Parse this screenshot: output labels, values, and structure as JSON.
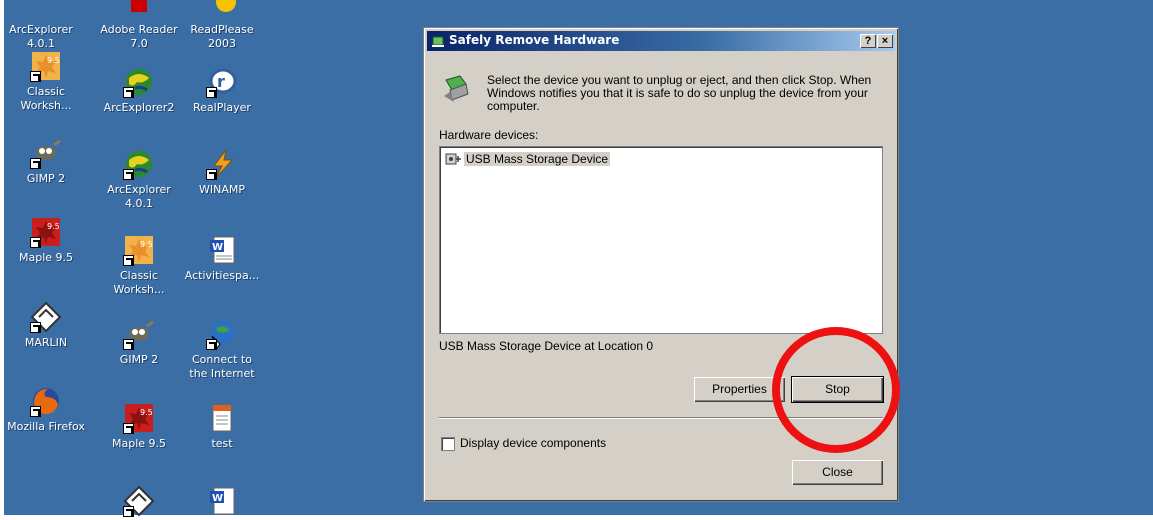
{
  "desktop": {
    "icons": [
      {
        "label": "ArcExplorer\n4.0.1",
        "icon": "globe-icon"
      },
      {
        "label": "Adobe Reader\n7.0",
        "icon": "pdf-icon"
      },
      {
        "label": "ReadPlease\n2003",
        "icon": "readplease-icon"
      },
      {
        "label": "Classic\nWorksh...",
        "icon": "maple-leaf-icon"
      },
      {
        "label": "ArcExplorer2",
        "icon": "globe-icon"
      },
      {
        "label": "RealPlayer",
        "icon": "realplayer-icon"
      },
      {
        "label": "GIMP 2",
        "icon": "gimp-icon"
      },
      {
        "label": "ArcExplorer\n4.0.1",
        "icon": "globe-icon"
      },
      {
        "label": "WINAMP",
        "icon": "winamp-icon"
      },
      {
        "label": "Maple 9.5",
        "icon": "maple-leaf-icon"
      },
      {
        "label": "Classic\nWorksh...",
        "icon": "maple-leaf-icon"
      },
      {
        "label": "Activitiespa...",
        "icon": "word-document-icon"
      },
      {
        "label": "MARLIN",
        "icon": "marlin-icon"
      },
      {
        "label": "GIMP 2",
        "icon": "gimp-icon"
      },
      {
        "label": "Connect to\nthe Internet",
        "icon": "connect-internet-icon"
      },
      {
        "label": "Mozilla Firefox",
        "icon": "firefox-icon"
      },
      {
        "label": "Maple 9.5",
        "icon": "maple-leaf-icon"
      },
      {
        "label": "test",
        "icon": "text-document-icon"
      },
      {
        "label": "",
        "icon": "marlin-icon"
      },
      {
        "label": "",
        "icon": "word-document-icon"
      }
    ]
  },
  "dialog": {
    "title": "Safely Remove Hardware",
    "help_button": "?",
    "close_x": "×",
    "description": "Select the device you want to unplug or eject, and then click Stop. When Windows notifies you that it is safe to do so unplug the device from your computer.",
    "devices_label": "Hardware devices:",
    "devices": [
      "USB Mass Storage Device"
    ],
    "location_text": "USB Mass Storage Device at Location 0",
    "properties_label": "Properties",
    "stop_label": "Stop",
    "checkbox_label": "Display device components",
    "checkbox_checked": false,
    "close_label": "Close"
  },
  "annotation": {
    "highlight_color": "#ee1111",
    "highlights": "stop-button"
  },
  "colors": {
    "desktop": "#3a6ea5",
    "dialog_face": "#d4d0c8",
    "titlebar": "#0a246a"
  }
}
